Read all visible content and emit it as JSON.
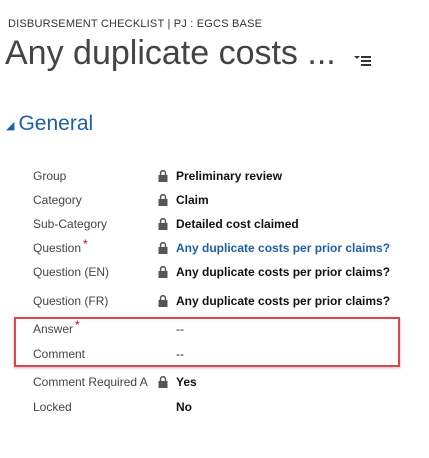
{
  "header": {
    "breadcrumb": "DISBURSEMENT CHECKLIST | PJ : EGCS BASE",
    "title": "Any duplicate costs ..."
  },
  "section": {
    "label": "General"
  },
  "fields": {
    "group": {
      "label": "Group",
      "value": "Preliminary review"
    },
    "category": {
      "label": "Category",
      "value": "Claim"
    },
    "subcategory": {
      "label": "Sub-Category",
      "value": "Detailed cost claimed"
    },
    "question": {
      "label": "Question",
      "required": "*",
      "value": "Any duplicate costs per prior claims?"
    },
    "question_en": {
      "label": "Question (EN)",
      "value": "Any duplicate costs per prior claims?"
    },
    "question_fr": {
      "label": "Question (FR)",
      "value": "Any duplicate costs per prior claims?"
    },
    "answer": {
      "label": "Answer",
      "required": "*",
      "value": "--"
    },
    "comment": {
      "label": "Comment",
      "value": "--"
    },
    "comment_required": {
      "label": "Comment Required A",
      "value": "Yes"
    },
    "locked": {
      "label": "Locked",
      "value": "No"
    }
  },
  "colors": {
    "link": "#1f5fa8",
    "required": "#d0021b",
    "highlight": "#e0454f"
  },
  "icons": [
    "lock-icon",
    "menu-icon",
    "collapse-arrow-icon"
  ]
}
